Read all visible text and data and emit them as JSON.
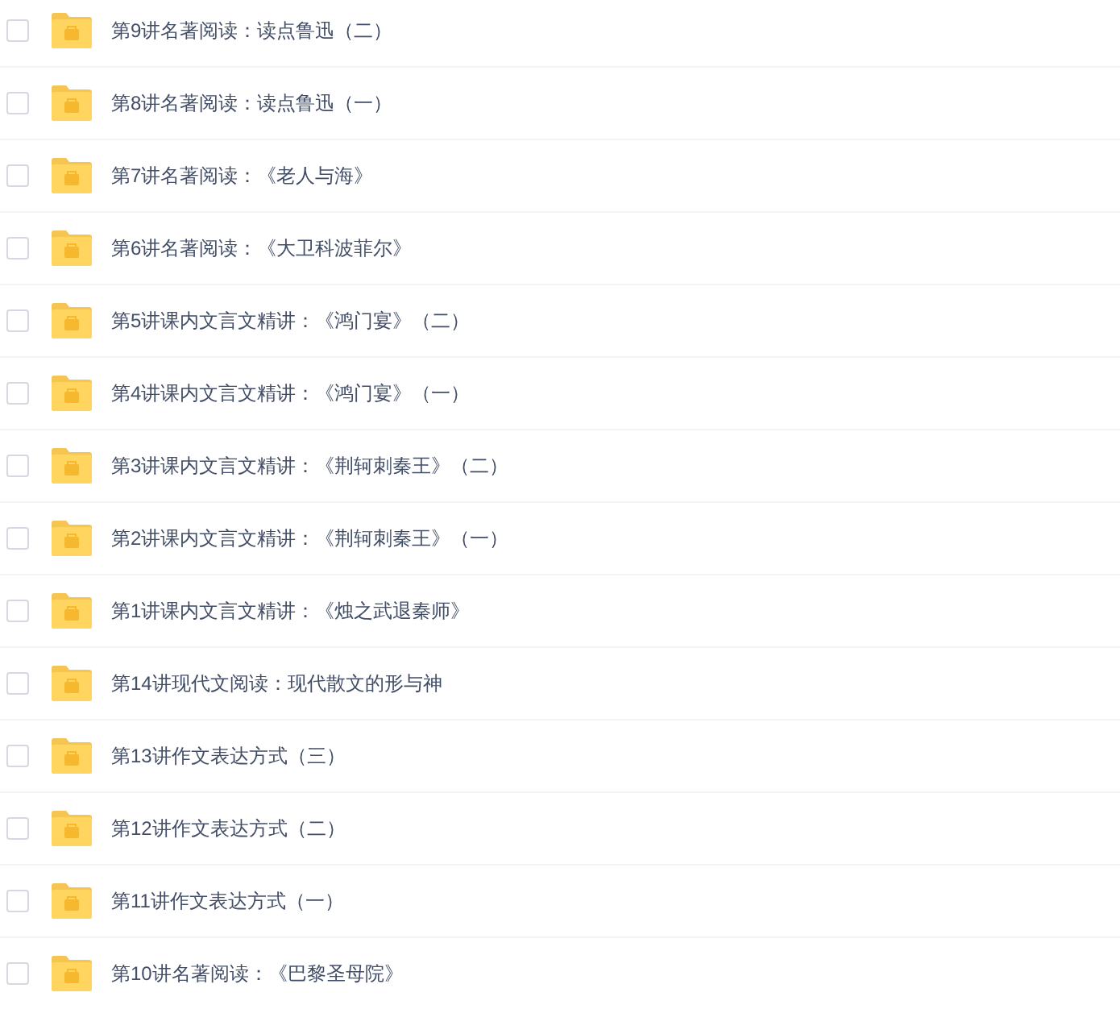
{
  "files": [
    {
      "name": "第9讲名著阅读：读点鲁迅（二）",
      "checked": false
    },
    {
      "name": "第8讲名著阅读：读点鲁迅（一）",
      "checked": false
    },
    {
      "name": "第7讲名著阅读：《老人与海》",
      "checked": false
    },
    {
      "name": "第6讲名著阅读：《大卫科波菲尔》",
      "checked": false
    },
    {
      "name": "第5讲课内文言文精讲：《鸿门宴》（二）",
      "checked": false
    },
    {
      "name": "第4讲课内文言文精讲：《鸿门宴》（一）",
      "checked": false
    },
    {
      "name": "第3讲课内文言文精讲：《荆轲刺秦王》（二）",
      "checked": false
    },
    {
      "name": "第2讲课内文言文精讲：《荆轲刺秦王》（一）",
      "checked": false
    },
    {
      "name": "第1讲课内文言文精讲：《烛之武退秦师》",
      "checked": false
    },
    {
      "name": "第14讲现代文阅读：现代散文的形与神",
      "checked": false
    },
    {
      "name": "第13讲作文表达方式（三）",
      "checked": false
    },
    {
      "name": "第12讲作文表达方式（二）",
      "checked": false
    },
    {
      "name": "第11讲作文表达方式（一）",
      "checked": false
    },
    {
      "name": "第10讲名著阅读：《巴黎圣母院》",
      "checked": false
    }
  ]
}
